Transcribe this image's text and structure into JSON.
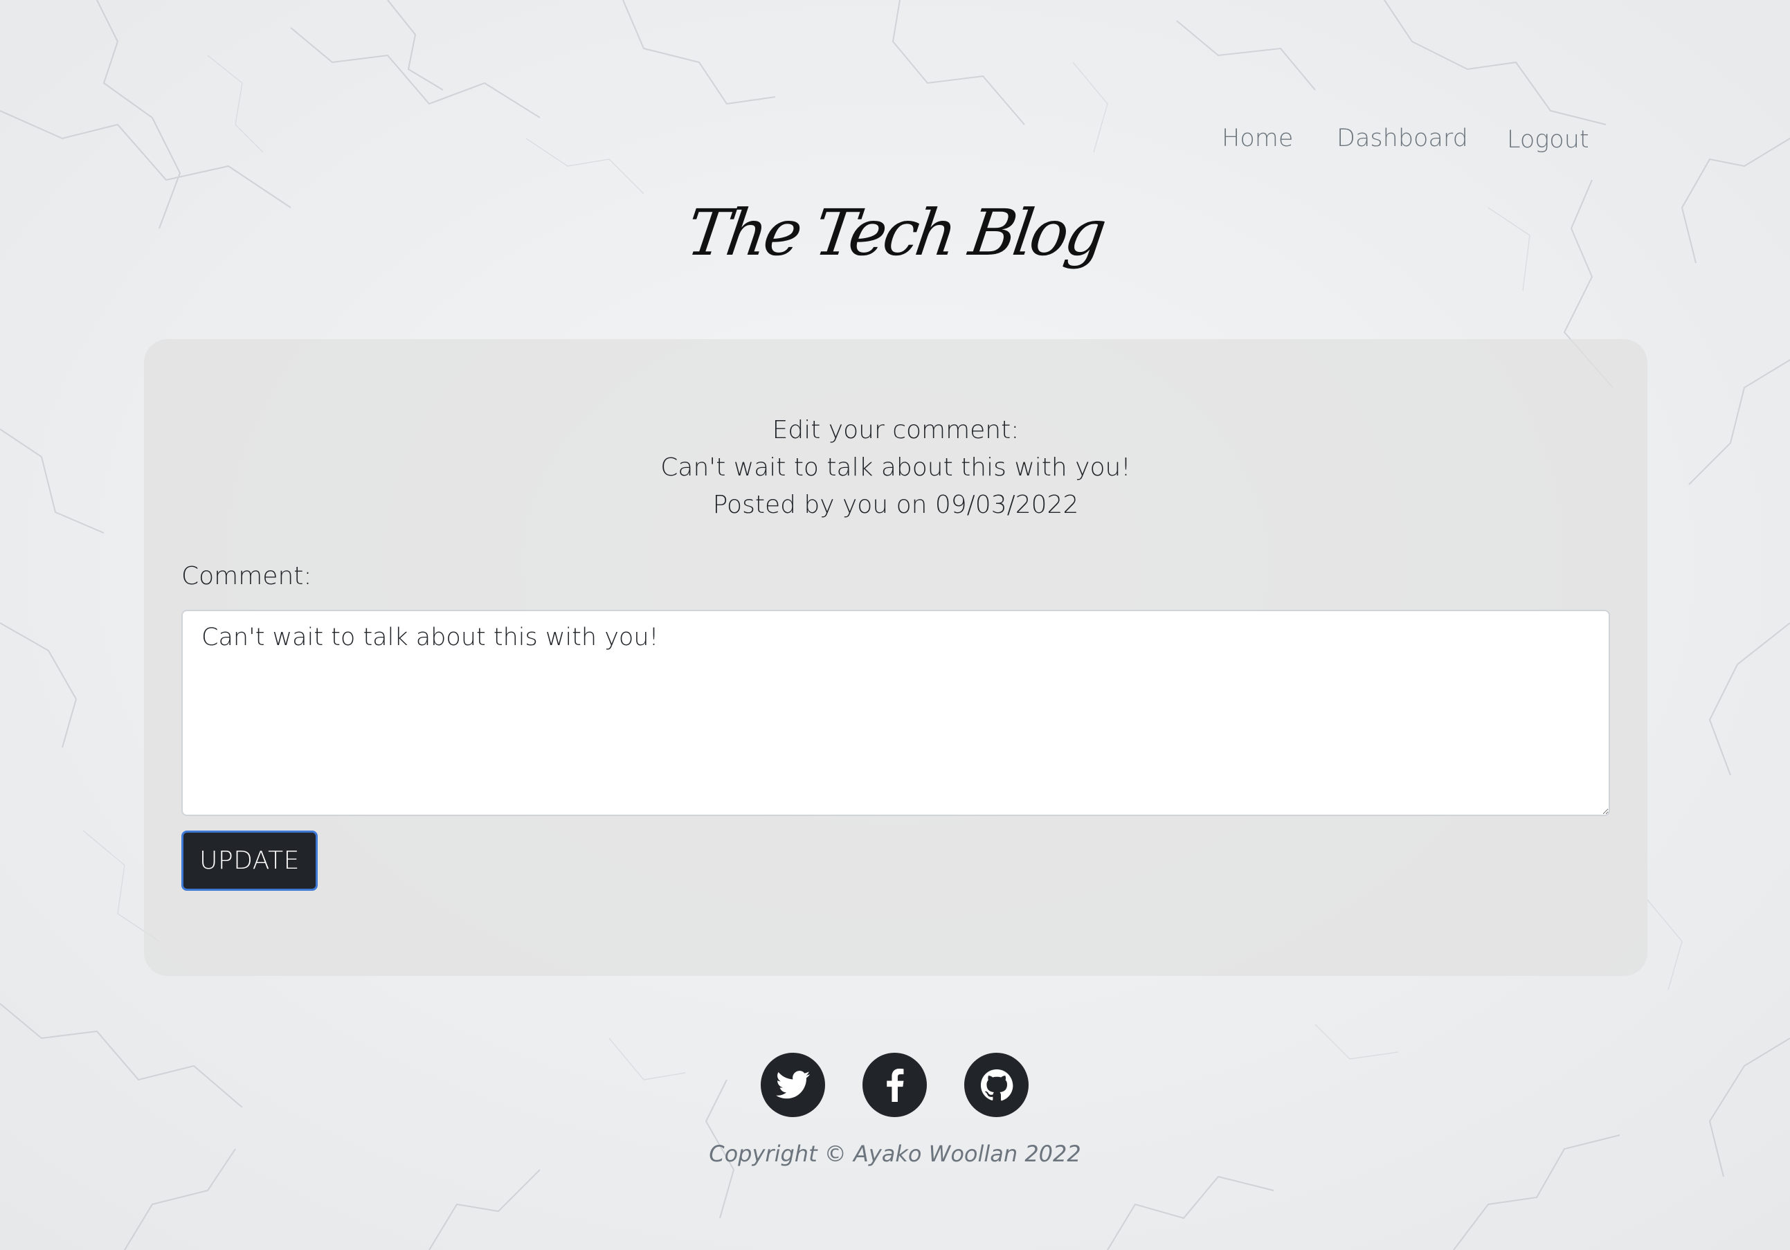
{
  "nav": {
    "home": "Home",
    "dashboard": "Dashboard",
    "logout": "Logout"
  },
  "brand": {
    "title": "The Tech Blog"
  },
  "comment_card": {
    "heading": "Edit your comment:",
    "original_comment": "Can't wait to talk about this with you!",
    "posted_by": "Posted by you on 09/03/2022",
    "field_label": "Comment:",
    "field_value": "Can't wait to talk about this with you!",
    "update_label": "UPDATE"
  },
  "footer": {
    "social_icons": [
      "twitter-icon",
      "facebook-icon",
      "github-icon"
    ],
    "copyright": "Copyright © Ayako Woollan 2022"
  },
  "colors": {
    "button_bg": "#212529",
    "button_focus_border": "#3f79d6",
    "nav_text": "#6c757d",
    "card_bg": "#e3e3e3"
  }
}
